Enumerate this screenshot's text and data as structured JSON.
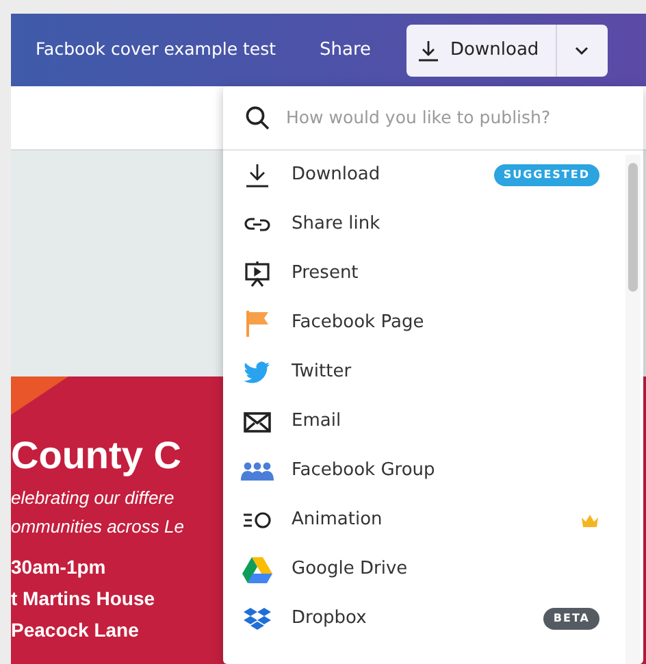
{
  "topbar": {
    "title": "Facbook cover example test",
    "share": "Share",
    "download": "Download"
  },
  "design": {
    "heading": "County C",
    "lines": [
      "elebrating our differe",
      "ommunities across Le"
    ],
    "details": [
      "30am-1pm",
      "t Martins House",
      "Peacock Lane"
    ]
  },
  "publish_menu": {
    "search": {
      "placeholder": "How would you like to publish?"
    },
    "items": [
      {
        "label": "Download",
        "badge": {
          "text": "SUGGESTED",
          "kind": "suggested"
        },
        "premium": false
      },
      {
        "label": "Share link",
        "premium": false
      },
      {
        "label": "Present",
        "premium": false
      },
      {
        "label": "Facebook Page",
        "premium": false
      },
      {
        "label": "Twitter",
        "premium": false
      },
      {
        "label": "Email",
        "premium": false
      },
      {
        "label": "Facebook Group",
        "premium": false
      },
      {
        "label": "Animation",
        "premium": true
      },
      {
        "label": "Google Drive",
        "premium": false
      },
      {
        "label": "Dropbox",
        "badge": {
          "text": "BETA",
          "kind": "beta"
        },
        "premium": false
      }
    ]
  }
}
